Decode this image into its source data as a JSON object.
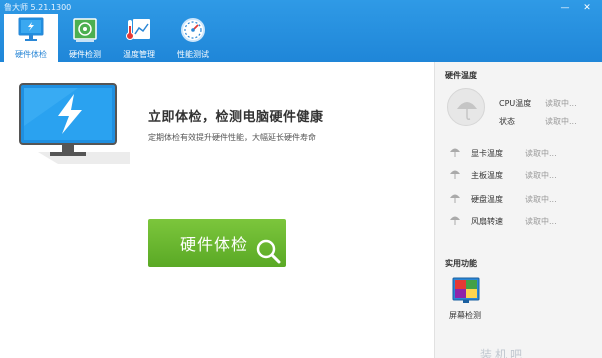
{
  "app": {
    "title": "鲁大师 5.21.1300"
  },
  "window_controls": {
    "minimize": "—",
    "close": "✕"
  },
  "nav": {
    "tabs": [
      {
        "label": "硬件体检",
        "icon": "monitor-check-icon",
        "active": true
      },
      {
        "label": "硬件检测",
        "icon": "circuit-board-icon",
        "active": false
      },
      {
        "label": "温度管理",
        "icon": "thermometer-icon",
        "active": false
      },
      {
        "label": "性能测试",
        "icon": "speedometer-icon",
        "active": false
      }
    ]
  },
  "main": {
    "title": "立即体检，检测电脑硬件健康",
    "subtitle": "定期体检有效提升硬件性能，大幅延长硬件寿命",
    "button_label": "硬件体检"
  },
  "right_panel": {
    "temp_heading": "硬件温度",
    "cpu": {
      "label": "CPU温度",
      "value": "读取中..."
    },
    "status": {
      "label": "状态",
      "value": "读取中..."
    },
    "sensors": [
      {
        "label": "显卡温度",
        "value": "读取中..."
      },
      {
        "label": "主板温度",
        "value": "读取中..."
      },
      {
        "label": "硬盘温度",
        "value": "读取中..."
      },
      {
        "label": "风扇转速",
        "value": "读取中..."
      }
    ],
    "tools_heading": "实用功能",
    "tools": [
      {
        "label": "屏幕检测",
        "icon": "screen-test-icon"
      }
    ]
  },
  "watermark": "装机吧",
  "colors": {
    "topbar": "#2390e0",
    "button_green": "#6bb832",
    "accent_blue": "#2a87d6",
    "monitor_blue": "#1f8fe0"
  }
}
